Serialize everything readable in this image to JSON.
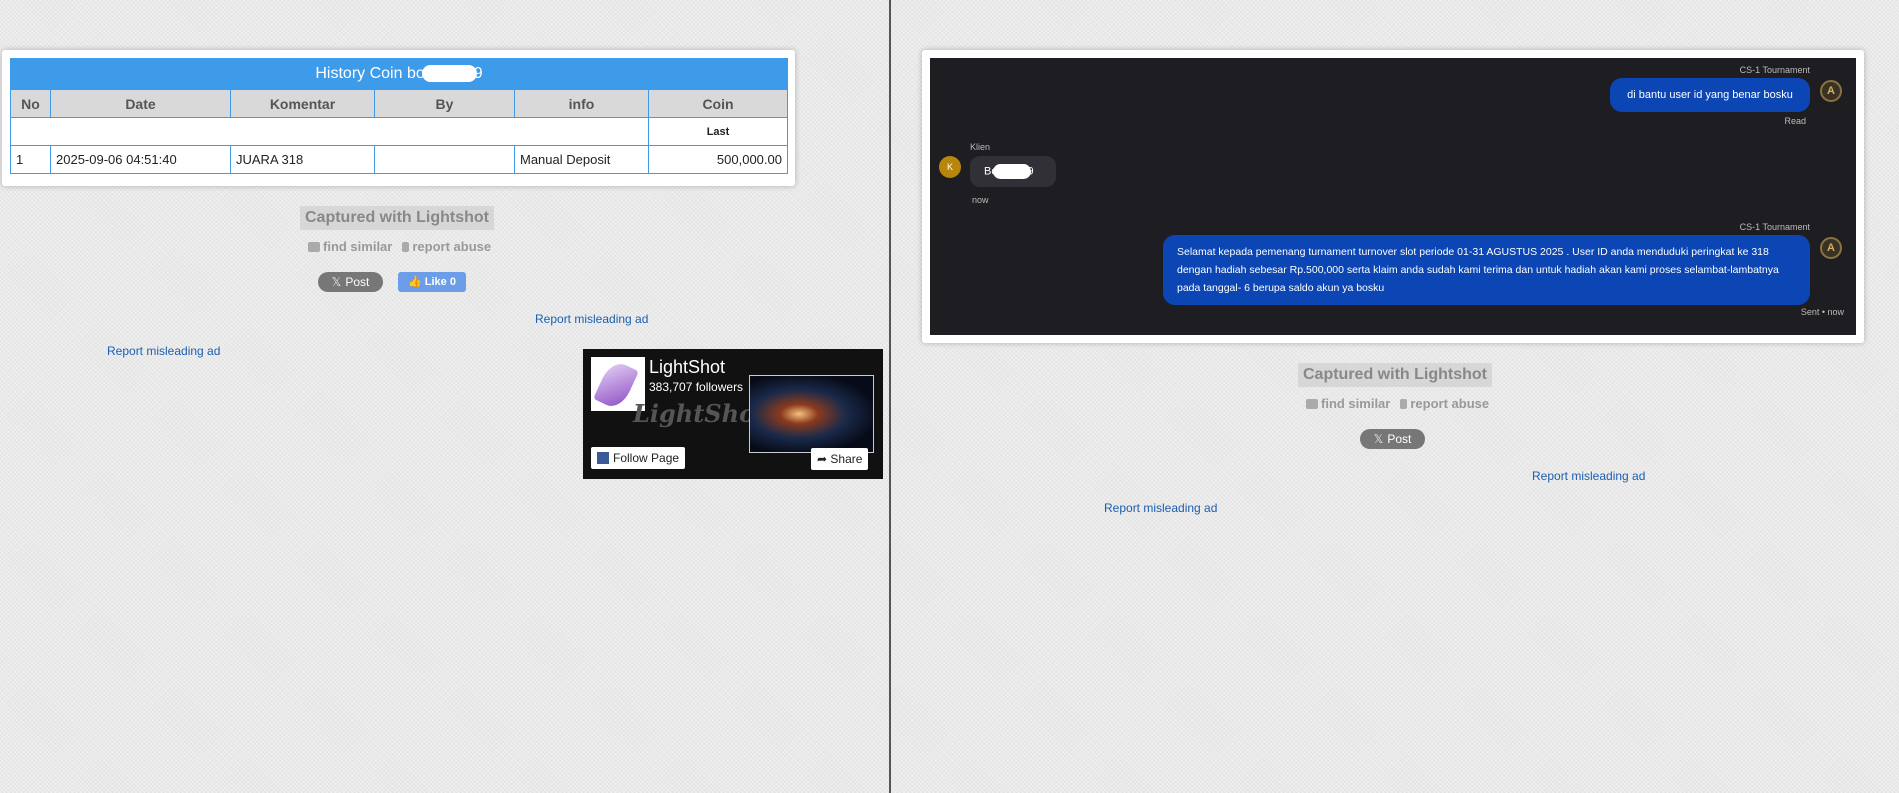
{
  "left": {
    "table": {
      "title_prefix": "History Coin bo",
      "title_suffix": "9",
      "headers": [
        "No",
        "Date",
        "Komentar",
        "By",
        "info",
        "Coin"
      ],
      "last_label": "Last",
      "rows": [
        {
          "no": "1",
          "date": "2025-09-06 04:51:40",
          "komentar": "JUARA 318",
          "by": "",
          "info": "Manual Deposit",
          "coin": "500,000.00"
        }
      ]
    },
    "captured": "Captured with Lightshot",
    "find_similar": "find similar",
    "report_abuse": "report abuse",
    "post": "Post",
    "like": "Like 0",
    "report_ad_1": "Report misleading ad",
    "report_ad_2": "Report misleading ad",
    "fb": {
      "name": "LightShot",
      "followers": "383,707 followers",
      "watermark": "LightShot",
      "follow": "Follow Page",
      "share": "Share"
    }
  },
  "right": {
    "chat": {
      "sender_1": "CS-1 Tournament",
      "msg_1": "di bantu user id yang benar bosku",
      "status_1": "Read",
      "client_label": "Klien",
      "client_avatar": "K",
      "client_msg_prefix": "Bo",
      "client_msg_suffix": "9",
      "client_time": "now",
      "sender_2": "CS-1 Tournament",
      "msg_2": "Selamat kepada pemenang turnament turnover slot periode 01-31 AGUSTUS 2025 . User ID anda menduduki peringkat ke 318 dengan hadiah sebesar Rp.500,000 serta klaim anda sudah kami terima dan untuk hadiah akan kami proses selambat-lambatnya pada tanggal- 6 berupa saldo akun ya bosku",
      "status_2": "Sent • now",
      "agent_avatar": "A"
    },
    "captured": "Captured with Lightshot",
    "find_similar": "find similar",
    "report_abuse": "report abuse",
    "post": "Post",
    "report_ad_1": "Report misleading ad",
    "report_ad_2": "Report misleading ad"
  },
  "colors": {
    "table_header": "#3d9be9",
    "coin_value": "#1a8a1a",
    "chat_bg": "#1e1e22",
    "bubble_out": "#0b46b4",
    "link": "#1c5fb0"
  }
}
